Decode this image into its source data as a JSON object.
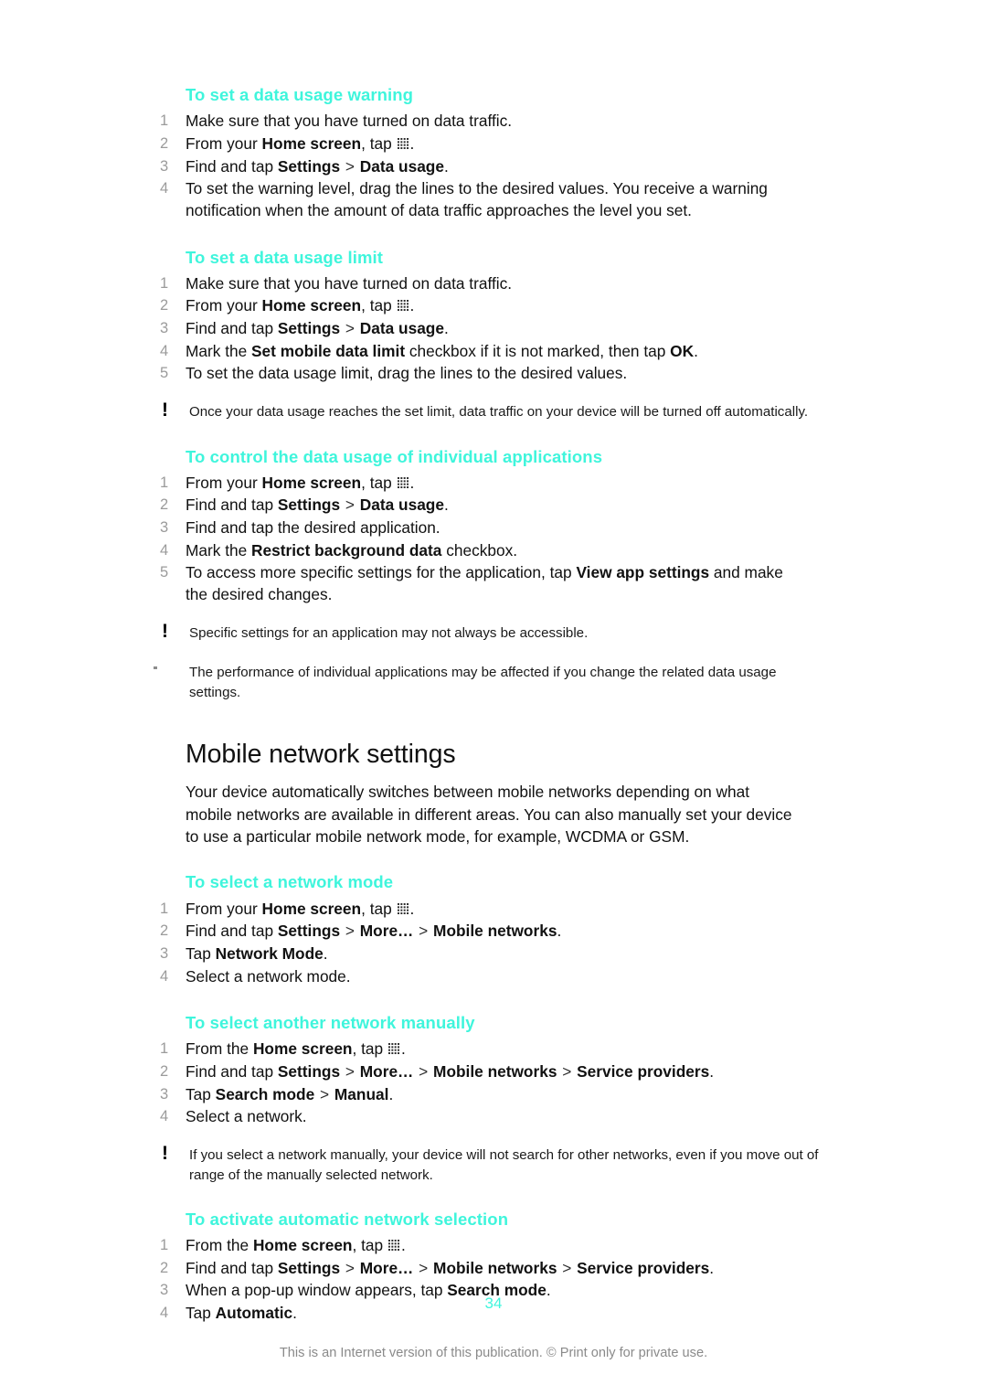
{
  "page": {
    "number": "34",
    "footer_note": "This is an Internet version of this publication. © Print only for private use."
  },
  "icons": {
    "app_drawer": "app-drawer-grid-icon",
    "warning_marker": "!",
    "bullet_marker": "·"
  },
  "sections": [
    {
      "id": "set-data-usage-warning",
      "heading": "To set a data usage warning",
      "steps": [
        {
          "num": "1",
          "parts": [
            {
              "t": "Make sure that you have turned on data traffic.",
              "b": false
            }
          ]
        },
        {
          "num": "2",
          "parts": [
            {
              "t": "From your ",
              "b": false
            },
            {
              "t": "Home screen",
              "b": true
            },
            {
              "t": ", tap ",
              "b": false
            },
            {
              "t": "[grid]",
              "b": false
            },
            {
              "t": ".",
              "b": false
            }
          ]
        },
        {
          "num": "3",
          "parts": [
            {
              "t": "Find and tap ",
              "b": false
            },
            {
              "t": "Settings",
              "b": true
            },
            {
              "t": " > ",
              "b": false,
              "sep": true
            },
            {
              "t": "Data usage",
              "b": true
            },
            {
              "t": ".",
              "b": false
            }
          ]
        },
        {
          "num": "4",
          "parts": [
            {
              "t": "To set the warning level, drag the lines to the desired values. You receive a warning notification when the amount of data traffic approaches the level you set.",
              "b": false
            }
          ]
        }
      ],
      "notes": []
    },
    {
      "id": "set-data-usage-limit",
      "heading": "To set a data usage limit",
      "steps": [
        {
          "num": "1",
          "parts": [
            {
              "t": "Make sure that you have turned on data traffic.",
              "b": false
            }
          ]
        },
        {
          "num": "2",
          "parts": [
            {
              "t": "From your ",
              "b": false
            },
            {
              "t": "Home screen",
              "b": true
            },
            {
              "t": ", tap ",
              "b": false
            },
            {
              "t": "[grid]",
              "b": false
            },
            {
              "t": ".",
              "b": false
            }
          ]
        },
        {
          "num": "3",
          "parts": [
            {
              "t": "Find and tap ",
              "b": false
            },
            {
              "t": "Settings",
              "b": true
            },
            {
              "t": " > ",
              "b": false,
              "sep": true
            },
            {
              "t": "Data usage",
              "b": true
            },
            {
              "t": ".",
              "b": false
            }
          ]
        },
        {
          "num": "4",
          "parts": [
            {
              "t": "Mark the ",
              "b": false
            },
            {
              "t": "Set mobile data limit",
              "b": true
            },
            {
              "t": " checkbox if it is not marked, then tap ",
              "b": false
            },
            {
              "t": "OK",
              "b": true
            },
            {
              "t": ".",
              "b": false
            }
          ]
        },
        {
          "num": "5",
          "parts": [
            {
              "t": "To set the data usage limit, drag the lines to the desired values.",
              "b": false
            }
          ]
        }
      ],
      "notes": [
        {
          "marker": "!",
          "text": "Once your data usage reaches the set limit, data traffic on your device will be turned off automatically."
        }
      ]
    },
    {
      "id": "control-data-usage-individual-apps",
      "heading": "To control the data usage of individual applications",
      "steps": [
        {
          "num": "1",
          "parts": [
            {
              "t": "From your ",
              "b": false
            },
            {
              "t": "Home screen",
              "b": true
            },
            {
              "t": ", tap ",
              "b": false
            },
            {
              "t": "[grid]",
              "b": false
            },
            {
              "t": ".",
              "b": false
            }
          ]
        },
        {
          "num": "2",
          "parts": [
            {
              "t": "Find and tap ",
              "b": false
            },
            {
              "t": "Settings",
              "b": true
            },
            {
              "t": " > ",
              "b": false,
              "sep": true
            },
            {
              "t": "Data usage",
              "b": true
            },
            {
              "t": ".",
              "b": false
            }
          ]
        },
        {
          "num": "3",
          "parts": [
            {
              "t": "Find and tap the desired application.",
              "b": false
            }
          ]
        },
        {
          "num": "4",
          "parts": [
            {
              "t": "Mark the ",
              "b": false
            },
            {
              "t": "Restrict background data",
              "b": true
            },
            {
              "t": " checkbox.",
              "b": false
            }
          ]
        },
        {
          "num": "5",
          "parts": [
            {
              "t": "To access more specific settings for the application, tap ",
              "b": false
            },
            {
              "t": "View app settings",
              "b": true
            },
            {
              "t": " and make the desired changes.",
              "b": false
            }
          ]
        }
      ],
      "notes": [
        {
          "marker": "!",
          "text": "Specific settings for an application may not always be accessible."
        },
        {
          "marker": "·",
          "text": "The performance of individual applications may be affected if you change the related data usage settings."
        }
      ]
    }
  ],
  "mobile_network": {
    "heading": "Mobile network settings",
    "paragraph": "Your device automatically switches between mobile networks depending on what mobile networks are available in different areas. You can also manually set your device to use a particular mobile network mode, for example, WCDMA or GSM.",
    "sections": [
      {
        "id": "select-network-mode",
        "heading": "To select a network mode",
        "steps": [
          {
            "num": "1",
            "parts": [
              {
                "t": "From your ",
                "b": false
              },
              {
                "t": "Home screen",
                "b": true
              },
              {
                "t": ", tap ",
                "b": false
              },
              {
                "t": "[grid]",
                "b": false
              },
              {
                "t": ".",
                "b": false
              }
            ]
          },
          {
            "num": "2",
            "parts": [
              {
                "t": "Find and tap ",
                "b": false
              },
              {
                "t": "Settings",
                "b": true
              },
              {
                "t": " > ",
                "b": false,
                "sep": true
              },
              {
                "t": "More…",
                "b": true
              },
              {
                "t": " > ",
                "b": false,
                "sep": true
              },
              {
                "t": "Mobile networks",
                "b": true
              },
              {
                "t": ".",
                "b": false
              }
            ]
          },
          {
            "num": "3",
            "parts": [
              {
                "t": "Tap ",
                "b": false
              },
              {
                "t": "Network Mode",
                "b": true
              },
              {
                "t": ".",
                "b": false
              }
            ]
          },
          {
            "num": "4",
            "parts": [
              {
                "t": "Select a network mode.",
                "b": false
              }
            ]
          }
        ],
        "notes": []
      },
      {
        "id": "select-another-network-manually",
        "heading": "To select another network manually",
        "steps": [
          {
            "num": "1",
            "parts": [
              {
                "t": "From the ",
                "b": false
              },
              {
                "t": "Home screen",
                "b": true
              },
              {
                "t": ", tap ",
                "b": false
              },
              {
                "t": "[grid]",
                "b": false
              },
              {
                "t": ".",
                "b": false
              }
            ]
          },
          {
            "num": "2",
            "parts": [
              {
                "t": "Find and tap ",
                "b": false
              },
              {
                "t": "Settings",
                "b": true
              },
              {
                "t": " > ",
                "b": false,
                "sep": true
              },
              {
                "t": "More…",
                "b": true
              },
              {
                "t": " > ",
                "b": false,
                "sep": true
              },
              {
                "t": "Mobile networks",
                "b": true
              },
              {
                "t": " > ",
                "b": false,
                "sep": true
              },
              {
                "t": "Service providers",
                "b": true
              },
              {
                "t": ".",
                "b": false
              }
            ]
          },
          {
            "num": "3",
            "parts": [
              {
                "t": "Tap ",
                "b": false
              },
              {
                "t": "Search mode",
                "b": true
              },
              {
                "t": " > ",
                "b": false,
                "sep": true
              },
              {
                "t": "Manual",
                "b": true
              },
              {
                "t": ".",
                "b": false
              }
            ]
          },
          {
            "num": "4",
            "parts": [
              {
                "t": "Select a network.",
                "b": false
              }
            ]
          }
        ],
        "notes": [
          {
            "marker": "!",
            "text": "If you select a network manually, your device will not search for other networks, even if you move out of range of the manually selected network."
          }
        ]
      },
      {
        "id": "activate-automatic-network-selection",
        "heading": "To activate automatic network selection",
        "steps": [
          {
            "num": "1",
            "parts": [
              {
                "t": "From the ",
                "b": false
              },
              {
                "t": "Home screen",
                "b": true
              },
              {
                "t": ", tap ",
                "b": false
              },
              {
                "t": "[grid]",
                "b": false
              },
              {
                "t": ".",
                "b": false
              }
            ]
          },
          {
            "num": "2",
            "parts": [
              {
                "t": "Find and tap ",
                "b": false
              },
              {
                "t": "Settings",
                "b": true
              },
              {
                "t": " > ",
                "b": false,
                "sep": true
              },
              {
                "t": "More…",
                "b": true
              },
              {
                "t": " > ",
                "b": false,
                "sep": true
              },
              {
                "t": "Mobile networks",
                "b": true
              },
              {
                "t": " > ",
                "b": false,
                "sep": true
              },
              {
                "t": "Service providers",
                "b": true
              },
              {
                "t": ".",
                "b": false
              }
            ]
          },
          {
            "num": "3",
            "parts": [
              {
                "t": "When a pop-up window appears, tap ",
                "b": false
              },
              {
                "t": "Search mode",
                "b": true
              },
              {
                "t": ".",
                "b": false
              }
            ]
          },
          {
            "num": "4",
            "parts": [
              {
                "t": "Tap ",
                "b": false
              },
              {
                "t": "Automatic",
                "b": true
              },
              {
                "t": ".",
                "b": false
              }
            ]
          }
        ],
        "notes": []
      }
    ]
  }
}
